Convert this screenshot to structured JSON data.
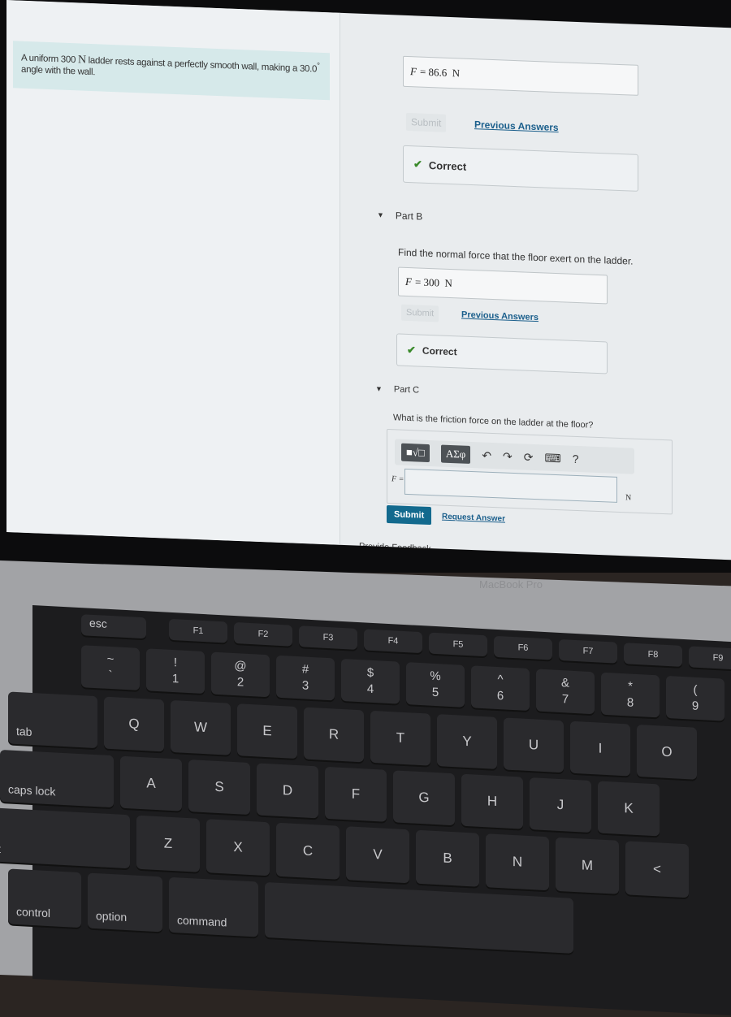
{
  "problem": {
    "text_a": "A uniform 300 ",
    "unit_a": "N",
    "text_b": " ladder rests against a perfectly smooth wall, making a 30.0",
    "unit_b": "°",
    "text_c": " angle with the wall."
  },
  "part_a": {
    "var": "F",
    "eq": "=",
    "value": "86.6",
    "unit": "N",
    "submit": "Submit",
    "prev": "Previous Answers",
    "correct": "Correct"
  },
  "part_b": {
    "title": "Part B",
    "question": "Find the normal force that the floor exert on the ladder.",
    "var": "F",
    "eq": "=",
    "value": "300",
    "unit": "N",
    "submit": "Submit",
    "prev": "Previous Answers",
    "correct": "Correct"
  },
  "part_c": {
    "title": "Part C",
    "question": "What is the friction force on the ladder at the floor?",
    "toolbar": {
      "templates": "■√□",
      "greek": "ΑΣφ",
      "undo": "undo-icon",
      "redo": "redo-icon",
      "reset": "reset-icon",
      "keyboard": "keyboard-icon",
      "help": "?"
    },
    "label": "F =",
    "value": "",
    "unit": "N",
    "submit": "Submit",
    "request": "Request Answer"
  },
  "feedback": "Provide Feedback",
  "laptop": {
    "brand": "MacBook Pro"
  },
  "keyboard": {
    "touchbar": [
      "esc"
    ],
    "fn": [
      "F1",
      "F2",
      "F3",
      "F4",
      "F5",
      "F6",
      "F7",
      "F8",
      "F9"
    ],
    "numbers": [
      [
        "~",
        "`"
      ],
      [
        "!",
        "1"
      ],
      [
        "@",
        "2"
      ],
      [
        "#",
        "3"
      ],
      [
        "$",
        "4"
      ],
      [
        "%",
        "5"
      ],
      [
        "^",
        "6"
      ],
      [
        "&",
        "7"
      ],
      [
        "*",
        "8"
      ],
      [
        "(",
        "9"
      ]
    ],
    "row_q": [
      "tab",
      "Q",
      "W",
      "E",
      "R",
      "T",
      "Y",
      "U",
      "I",
      "O"
    ],
    "row_a": [
      "caps lock",
      "A",
      "S",
      "D",
      "F",
      "G",
      "H",
      "J",
      "K"
    ],
    "row_z": [
      "ift",
      "Z",
      "X",
      "C",
      "V",
      "B",
      "N",
      "M",
      "<"
    ],
    "row_bottom": [
      "control",
      "option",
      "command",
      ""
    ]
  }
}
